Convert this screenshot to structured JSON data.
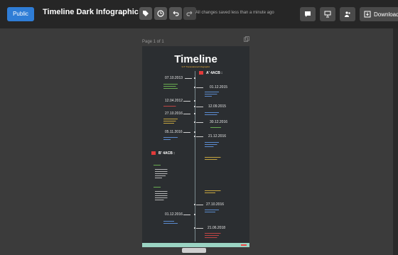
{
  "topbar": {
    "public_label": "Public",
    "doc_title": "Timeline Dark Infographic",
    "save_status": "All changes saved less than a minute ago",
    "download_label": "Download"
  },
  "canvas": {
    "page_label": "Page 1 of 1"
  },
  "infographic": {
    "title": "Timeline",
    "subtitle": "9 IT Transnational Infographic",
    "section1": "A' 4ACB :",
    "section2": "B' 4ACB :",
    "dates": [
      "07.10.2013",
      "01.12.2015",
      "12.04.2012",
      "12.09.2015",
      "27.10.2016",
      "30.12.2016",
      "05.11.2016",
      "21.12.2016",
      "27.10.2016",
      "01.12.2016",
      "21.06.2018"
    ]
  }
}
